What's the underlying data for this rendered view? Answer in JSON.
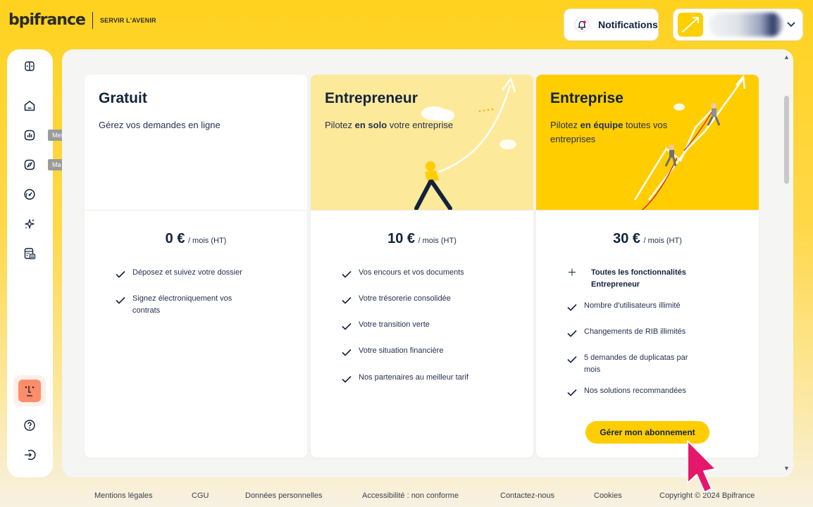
{
  "header": {
    "logo_text": "bpifrance",
    "tagline": "SERVIR L'AVENIR",
    "notifications_label": "Notifications",
    "bell_icon": "bell-icon",
    "account_chevron": "chevron-down-icon"
  },
  "sidebar": {
    "icons": [
      "panel-toggle-icon",
      "home-icon",
      "chart-icon",
      "compass-icon",
      "gauge-icon",
      "sparkles-icon",
      "calculator-icon",
      "help-icon",
      "logout-icon"
    ],
    "tooltips": {
      "financements": "Mes financements",
      "trajectoire": "Ma trajectoire"
    }
  },
  "plans": [
    {
      "title": "Gratuit",
      "desc_plain": "Gérez vos demandes en ligne",
      "price": "0 €",
      "unit": "/ mois (HT)",
      "features": [
        "Déposez et suivez votre dossier",
        "Signez électroniquement vos contrats"
      ]
    },
    {
      "title": "Entrepreneur",
      "desc_pre": "Pilotez ",
      "desc_bold": "en solo",
      "desc_post": " votre entreprise",
      "price": "10 €",
      "unit": "/ mois (HT)",
      "features": [
        "Vos encours et vos documents",
        "Votre trésorerie consolidée",
        "Votre transition verte",
        "Votre situation financière",
        "Nos partenaires au meilleur tarif"
      ]
    },
    {
      "title": "Entreprise",
      "desc_pre": "Pilotez ",
      "desc_bold": "en équipe",
      "desc_post": " toutes vos entreprises",
      "price": "30 €",
      "unit": "/ mois (HT)",
      "plus_feature": "Toutes les fonctionnalités Entrepreneur",
      "features": [
        "Nombre d'utilisateurs illimité",
        "Changements de RIB illimités",
        "5 demandes de duplicatas par mois",
        "Nos solutions recommandées"
      ],
      "button": "Gérer mon abonnement"
    }
  ],
  "footer": {
    "links": [
      "Mentions légales",
      "CGU",
      "Données personnelles",
      "Accessibilité : non conforme",
      "Contactez-nous",
      "Cookies"
    ],
    "copyright": "Copyright © 2024 Bpifrance"
  },
  "colors": {
    "brand_yellow": "#ffcd00",
    "light_yellow": "#fde99a",
    "navy": "#12223d",
    "cursor_pink": "#e5176b"
  }
}
